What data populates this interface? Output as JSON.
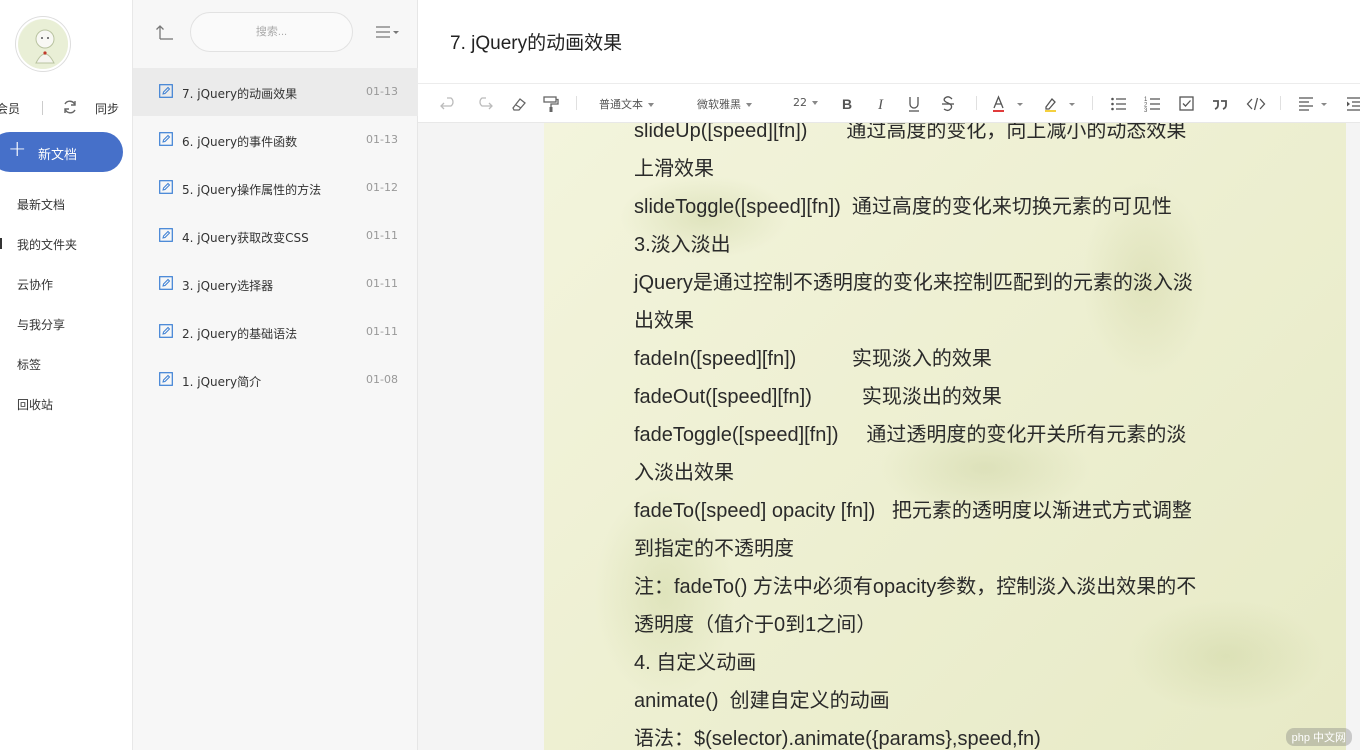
{
  "sidebar": {
    "member_label": "会员",
    "sync_label": "同步",
    "new_doc_label": "新文档",
    "items": [
      {
        "label": "最新文档",
        "active": false
      },
      {
        "label": "我的文件夹",
        "active": true
      },
      {
        "label": "云协作",
        "active": false
      },
      {
        "label": "与我分享",
        "active": false
      },
      {
        "label": "标签",
        "active": false
      },
      {
        "label": "回收站",
        "active": false
      }
    ]
  },
  "list": {
    "search_placeholder": "搜索...",
    "docs": [
      {
        "title": "7. jQuery的动画效果",
        "date": "01-13"
      },
      {
        "title": "6. jQuery的事件函数",
        "date": "01-13"
      },
      {
        "title": "5. jQuery操作属性的方法",
        "date": "01-12"
      },
      {
        "title": "4. jQuery获取改变CSS",
        "date": "01-11"
      },
      {
        "title": "3. jQuery选择器",
        "date": "01-11"
      },
      {
        "title": "2. jQuery的基础语法",
        "date": "01-11"
      },
      {
        "title": "1. jQuery简介",
        "date": "01-08"
      }
    ]
  },
  "editor": {
    "title": "7. jQuery的动画效果",
    "toolbar": {
      "paragraph_style": "普通文本",
      "font_family": "微软雅黑",
      "font_size": "22"
    },
    "lines": [
      "slideUp([speed][fn])       通过高度的变化，向上减小的动态效果",
      "上滑效果",
      "slideToggle([speed][fn])  通过高度的变化来切换元素的可见性",
      "3.淡入淡出",
      "jQuery是通过控制不透明度的变化来控制匹配到的元素的淡入淡",
      "出效果",
      "fadeIn([speed][fn])          实现淡入的效果",
      "fadeOut([speed][fn])         实现淡出的效果",
      "fadeToggle([speed][fn])     通过透明度的变化开关所有元素的淡",
      "入淡出效果",
      "fadeTo([speed] opacity [fn])   把元素的透明度以渐进式方式调整",
      "到指定的不透明度",
      "注：fadeTo() 方法中必须有opacity参数，控制淡入淡出效果的不",
      "透明度（值介于0到1之间）",
      "4. 自定义动画",
      "animate()  创建自定义的动画",
      "语法：$(selector).animate({params},speed,fn)"
    ]
  },
  "watermark": "php 中文网",
  "colors": {
    "accent": "#4670c9",
    "doc_icon": "#3b7fd4",
    "paper": "#eef0d2"
  }
}
